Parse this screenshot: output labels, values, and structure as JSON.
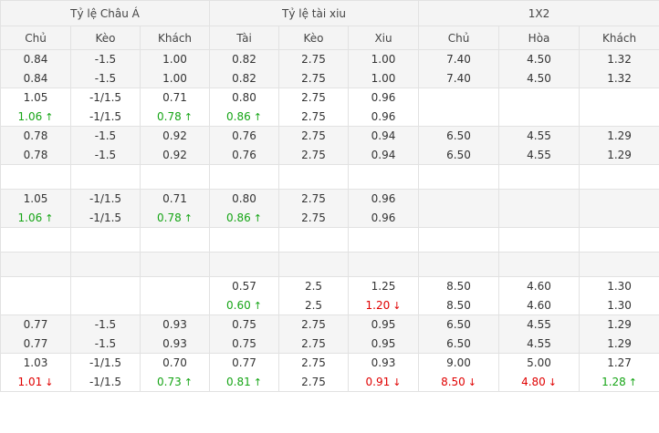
{
  "header": {
    "groups": [
      "Tỷ lệ Châu Á",
      "Tỷ lệ tài xiu",
      "1X2"
    ],
    "columns": [
      "Chủ",
      "Kèo",
      "Khách",
      "Tài",
      "Kèo",
      "Xiu",
      "Chủ",
      "Hòa",
      "Khách"
    ]
  },
  "colors": {
    "up": "#16a516",
    "down": "#e00000",
    "odd_row": "#f5f5f5",
    "even_row": "#ffffff",
    "border": "#e2e2e2"
  },
  "rows": [
    {
      "h": 41,
      "cells": [
        [
          {
            "v": "0.84"
          },
          {
            "v": "0.84"
          }
        ],
        [
          {
            "v": "-1.5"
          },
          {
            "v": "-1.5"
          }
        ],
        [
          {
            "v": "1.00"
          },
          {
            "v": "1.00"
          }
        ],
        [
          {
            "v": "0.82"
          },
          {
            "v": "0.82"
          }
        ],
        [
          {
            "v": "2.75"
          },
          {
            "v": "2.75"
          }
        ],
        [
          {
            "v": "1.00"
          },
          {
            "v": "1.00"
          }
        ],
        [
          {
            "v": "7.40"
          },
          {
            "v": "7.40"
          }
        ],
        [
          {
            "v": "4.50"
          },
          {
            "v": "4.50"
          }
        ],
        [
          {
            "v": "1.32"
          },
          {
            "v": "1.32"
          }
        ]
      ]
    },
    {
      "h": 41,
      "cells": [
        [
          {
            "v": "1.05"
          },
          {
            "v": "1.06",
            "t": "up"
          }
        ],
        [
          {
            "v": "-1/1.5"
          },
          {
            "v": "-1/1.5"
          }
        ],
        [
          {
            "v": "0.71"
          },
          {
            "v": "0.78",
            "t": "up"
          }
        ],
        [
          {
            "v": "0.80"
          },
          {
            "v": "0.86",
            "t": "up"
          }
        ],
        [
          {
            "v": "2.75"
          },
          {
            "v": "2.75"
          }
        ],
        [
          {
            "v": "0.96"
          },
          {
            "v": "0.96"
          }
        ],
        [],
        [],
        []
      ]
    },
    {
      "h": 41,
      "cells": [
        [
          {
            "v": "0.78"
          },
          {
            "v": "0.78"
          }
        ],
        [
          {
            "v": "-1.5"
          },
          {
            "v": "-1.5"
          }
        ],
        [
          {
            "v": "0.92"
          },
          {
            "v": "0.92"
          }
        ],
        [
          {
            "v": "0.76"
          },
          {
            "v": "0.76"
          }
        ],
        [
          {
            "v": "2.75"
          },
          {
            "v": "2.75"
          }
        ],
        [
          {
            "v": "0.94"
          },
          {
            "v": "0.94"
          }
        ],
        [
          {
            "v": "6.50"
          },
          {
            "v": "6.50"
          }
        ],
        [
          {
            "v": "4.55"
          },
          {
            "v": "4.55"
          }
        ],
        [
          {
            "v": "1.29"
          },
          {
            "v": "1.29"
          }
        ]
      ]
    },
    {
      "h": 27,
      "cells": [
        [],
        [],
        [],
        [],
        [],
        [],
        [],
        [],
        []
      ]
    },
    {
      "h": 41,
      "cells": [
        [
          {
            "v": "1.05"
          },
          {
            "v": "1.06",
            "t": "up"
          }
        ],
        [
          {
            "v": "-1/1.5"
          },
          {
            "v": "-1/1.5"
          }
        ],
        [
          {
            "v": "0.71"
          },
          {
            "v": "0.78",
            "t": "up"
          }
        ],
        [
          {
            "v": "0.80"
          },
          {
            "v": "0.86",
            "t": "up"
          }
        ],
        [
          {
            "v": "2.75"
          },
          {
            "v": "2.75"
          }
        ],
        [
          {
            "v": "0.96"
          },
          {
            "v": "0.96"
          }
        ],
        [],
        [],
        []
      ]
    },
    {
      "h": 27,
      "cells": [
        [],
        [],
        [],
        [],
        [],
        [],
        [],
        [],
        []
      ]
    },
    {
      "h": 27,
      "cells": [
        [],
        [],
        [],
        [],
        [],
        [],
        [],
        [],
        []
      ]
    },
    {
      "h": 41,
      "cells": [
        [],
        [],
        [],
        [
          {
            "v": "0.57"
          },
          {
            "v": "0.60",
            "t": "up"
          }
        ],
        [
          {
            "v": "2.5"
          },
          {
            "v": "2.5"
          }
        ],
        [
          {
            "v": "1.25"
          },
          {
            "v": "1.20",
            "t": "down"
          }
        ],
        [
          {
            "v": "8.50"
          },
          {
            "v": "8.50"
          }
        ],
        [
          {
            "v": "4.60"
          },
          {
            "v": "4.60"
          }
        ],
        [
          {
            "v": "1.30"
          },
          {
            "v": "1.30"
          }
        ]
      ]
    },
    {
      "h": 41,
      "cells": [
        [
          {
            "v": "0.77"
          },
          {
            "v": "0.77"
          }
        ],
        [
          {
            "v": "-1.5"
          },
          {
            "v": "-1.5"
          }
        ],
        [
          {
            "v": "0.93"
          },
          {
            "v": "0.93"
          }
        ],
        [
          {
            "v": "0.75"
          },
          {
            "v": "0.75"
          }
        ],
        [
          {
            "v": "2.75"
          },
          {
            "v": "2.75"
          }
        ],
        [
          {
            "v": "0.95"
          },
          {
            "v": "0.95"
          }
        ],
        [
          {
            "v": "6.50"
          },
          {
            "v": "6.50"
          }
        ],
        [
          {
            "v": "4.55"
          },
          {
            "v": "4.55"
          }
        ],
        [
          {
            "v": "1.29"
          },
          {
            "v": "1.29"
          }
        ]
      ]
    },
    {
      "h": 41,
      "cells": [
        [
          {
            "v": "1.03"
          },
          {
            "v": "1.01",
            "t": "down"
          }
        ],
        [
          {
            "v": "-1/1.5"
          },
          {
            "v": "-1/1.5"
          }
        ],
        [
          {
            "v": "0.70"
          },
          {
            "v": "0.73",
            "t": "up"
          }
        ],
        [
          {
            "v": "0.77"
          },
          {
            "v": "0.81",
            "t": "up"
          }
        ],
        [
          {
            "v": "2.75"
          },
          {
            "v": "2.75"
          }
        ],
        [
          {
            "v": "0.93"
          },
          {
            "v": "0.91",
            "t": "down"
          }
        ],
        [
          {
            "v": "9.00"
          },
          {
            "v": "8.50",
            "t": "down"
          }
        ],
        [
          {
            "v": "5.00"
          },
          {
            "v": "4.80",
            "t": "down"
          }
        ],
        [
          {
            "v": "1.27"
          },
          {
            "v": "1.28",
            "t": "up"
          }
        ]
      ]
    }
  ]
}
